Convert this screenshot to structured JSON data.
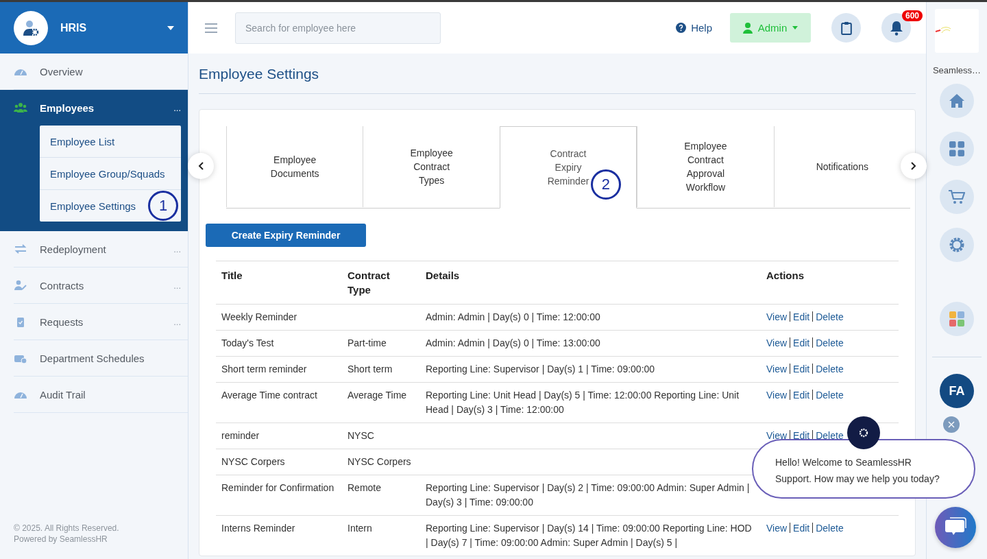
{
  "sidebar": {
    "brand": "HRIS",
    "items": [
      {
        "label": "Overview",
        "expanded": false
      },
      {
        "label": "Employees",
        "expanded": true,
        "more": "...",
        "children": [
          {
            "label": "Employee List"
          },
          {
            "label": "Employee Group/Squads"
          },
          {
            "label": "Employee Settings",
            "marker": "1"
          }
        ]
      },
      {
        "label": "Redeployment",
        "expanded": false,
        "more": "..."
      },
      {
        "label": "Contracts",
        "expanded": false,
        "more": "..."
      },
      {
        "label": "Requests",
        "expanded": false,
        "more": "..."
      },
      {
        "label": "Department Schedules",
        "expanded": false
      },
      {
        "label": "Audit Trail",
        "expanded": false
      }
    ],
    "footer": [
      "© 2025. All Rights Reserved.",
      "Powered by SeamlessHR"
    ]
  },
  "topbar": {
    "search_placeholder": "Search for employee here",
    "help": "Help",
    "user": "Admin",
    "notification_count": "600"
  },
  "page_title": "Employee Settings",
  "tabs": [
    {
      "label": "Employee Documents",
      "selected": false
    },
    {
      "label": "Employee Contract Types",
      "selected": false
    },
    {
      "label": "Contract Expiry Reminder",
      "selected": true,
      "marker": "2"
    },
    {
      "label": "Employee Contract Approval Workflow",
      "selected": false
    },
    {
      "label": "Notifications",
      "selected": false
    }
  ],
  "create_button": "Create Expiry Reminder",
  "table": {
    "columns": [
      "Title",
      "Contract Type",
      "Details",
      "Actions"
    ],
    "rows": [
      {
        "title": "Weekly Reminder",
        "details": "Admin: Admin | Day(s) 0 | Time: 12:00:00",
        "actions": [
          "View",
          "Edit",
          "Delete"
        ]
      },
      {
        "title": "Today's Test",
        "contract_type": "Part-time",
        "details": "Admin: Admin | Day(s) 0 | Time: 13:00:00",
        "actions": [
          "View",
          "Edit",
          "Delete"
        ]
      },
      {
        "title": "Short term reminder",
        "contract_type": "Short term",
        "details": "Reporting Line: Supervisor | Day(s) 1 | Time: 09:00:00",
        "actions": [
          "View",
          "Edit",
          "Delete"
        ]
      },
      {
        "title": "Average Time contract",
        "contract_type": "Average Time",
        "details": "Reporting Line: Unit Head | Day(s) 5 | Time: 12:00:00 Reporting Line: Unit Head | Day(s) 3 | Time: 12:00:00",
        "actions": [
          "View",
          "Edit",
          "Delete"
        ]
      },
      {
        "title": "reminder",
        "contract_type": "NYSC",
        "actions": [
          "View",
          "Edit",
          "Delete"
        ]
      },
      {
        "title": "NYSC Corpers",
        "contract_type": "NYSC Corpers"
      },
      {
        "title": "Reminder for Confirmation",
        "contract_type": "Remote",
        "details": "Reporting Line: Supervisor | Day(s) 2 | Time: 09:00:00 Admin: Super Admin | Day(s) 3 | Time: 09:00:00"
      },
      {
        "title": "Interns Reminder",
        "contract_type": "Intern",
        "details": "Reporting Line: Supervisor | Day(s) 14 | Time: 09:00:00 Reporting Line: HOD | Day(s) 7 | Time: 09:00:00 Admin: Super Admin | Day(s) 5 |",
        "actions": [
          "View",
          "Edit",
          "Delete"
        ]
      }
    ]
  },
  "rail": {
    "brand": "Seamless…",
    "avatar": "FA"
  },
  "chat": {
    "message": "Hello! Welcome to SeamlessHR Support. How may we help you today?"
  }
}
